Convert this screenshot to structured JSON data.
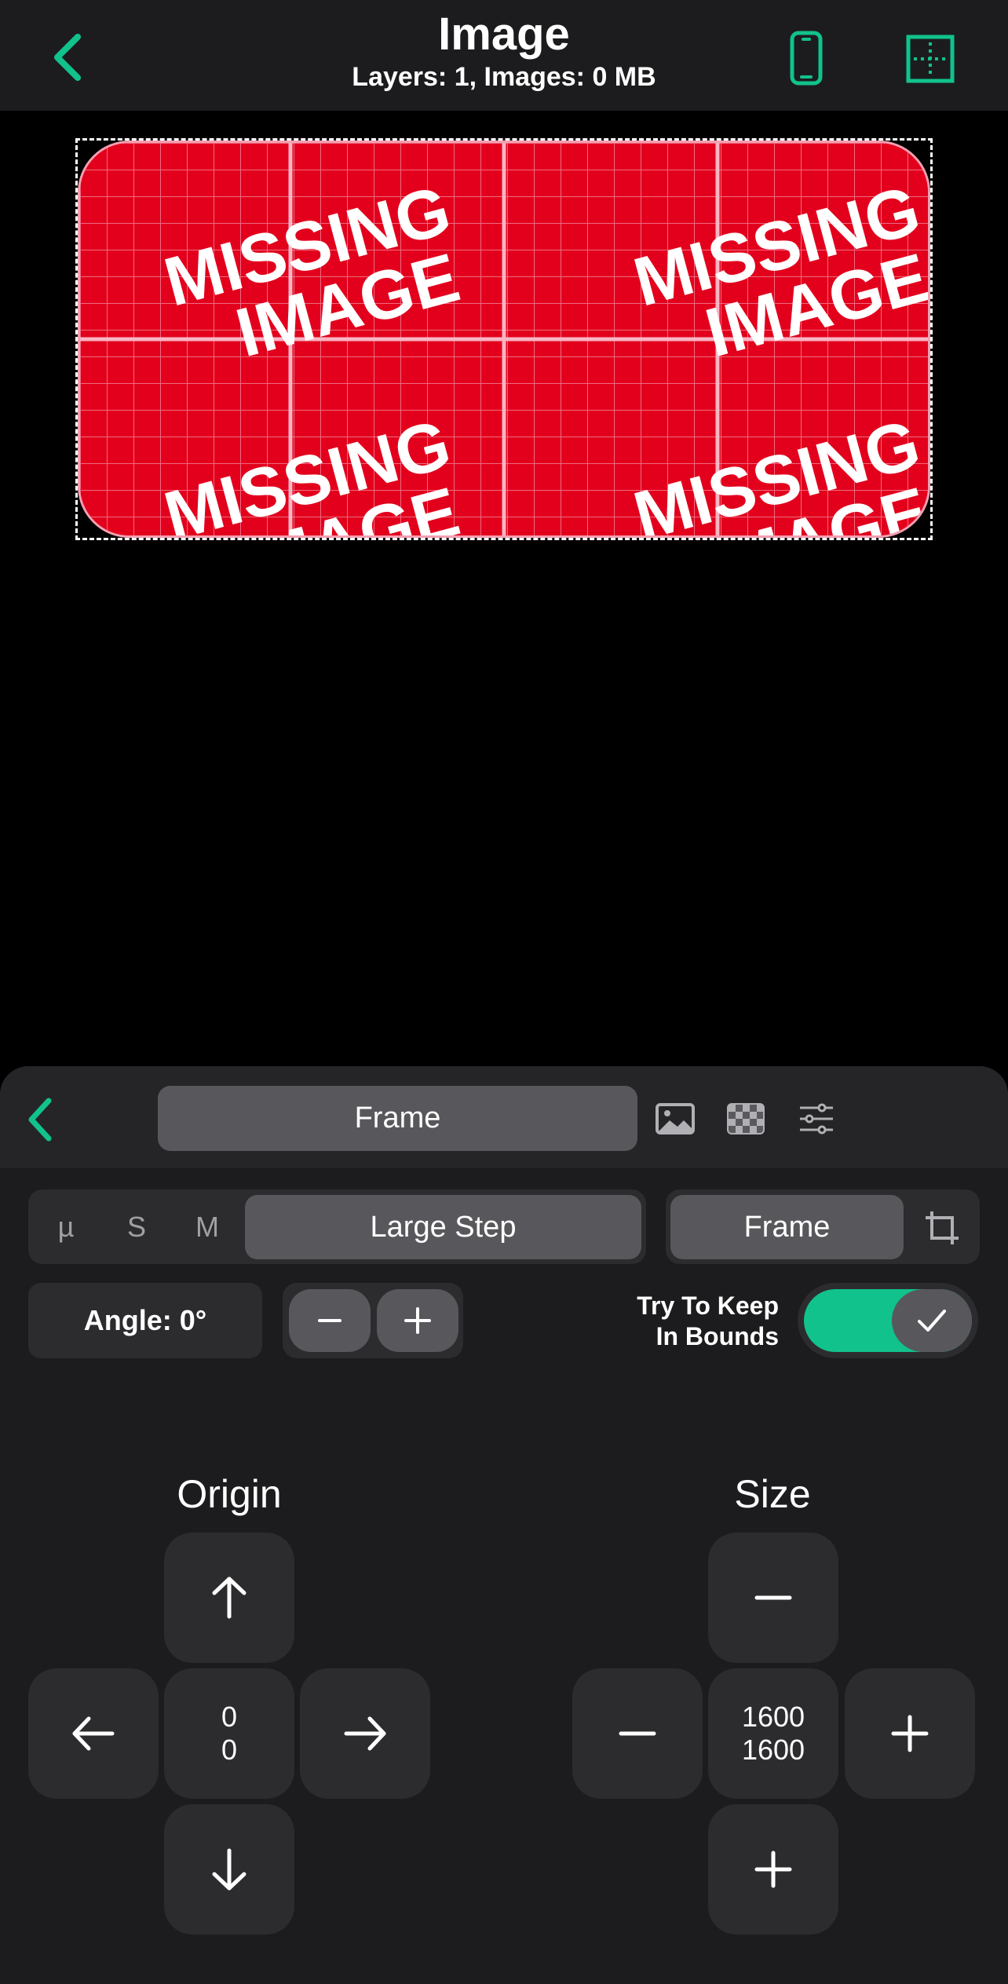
{
  "header": {
    "title": "Image",
    "subtitle": "Layers: 1, Images: 0 MB"
  },
  "canvas": {
    "placeholder_text": "MISSING IMAGE"
  },
  "panel": {
    "tab_label": "Frame",
    "step_options": [
      "µ",
      "S",
      "M",
      "Large Step"
    ],
    "selected_step": "Large Step",
    "mode_label": "Frame",
    "angle_label": "Angle: 0°",
    "keep_in_bounds_label_line1": "Try To Keep",
    "keep_in_bounds_label_line2": "In Bounds",
    "keep_in_bounds_on": true,
    "origin": {
      "title": "Origin",
      "x": "0",
      "y": "0"
    },
    "size": {
      "title": "Size",
      "width": "1600",
      "height": "1600"
    }
  },
  "colors": {
    "accent": "#11c28c",
    "background": "#000000",
    "panel": "#1c1c1e",
    "missing_red": "#e2001c"
  },
  "icons": [
    "back-chevron-icon",
    "phone-icon",
    "grid-crosshair-icon",
    "image-icon",
    "checkerboard-icon",
    "sliders-icon",
    "crop-icon",
    "minus-icon",
    "plus-icon",
    "arrow-up-icon",
    "arrow-down-icon",
    "arrow-left-icon",
    "arrow-right-icon",
    "checkmark-icon"
  ]
}
